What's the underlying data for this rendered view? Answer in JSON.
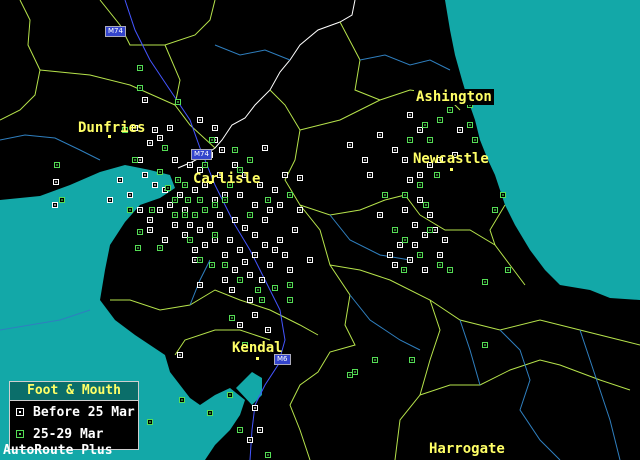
{
  "cities": [
    {
      "id": "dumfries",
      "name": "Dunfries"
    },
    {
      "id": "carlisle",
      "name": "Carlisle"
    },
    {
      "id": "kendal",
      "name": "Kendal"
    },
    {
      "id": "ashington",
      "name": "Ashington"
    },
    {
      "id": "newcastle",
      "name": "Newcastle"
    },
    {
      "id": "harrogate",
      "name": "Harrogate"
    }
  ],
  "road_signs": [
    "M74",
    "M74",
    "M6"
  ],
  "legend": {
    "title": "Foot & Mouth",
    "items": [
      {
        "label": "Before 25 Mar",
        "color": "#ffffff"
      },
      {
        "label": "25-29 Mar",
        "color": "#55dd55"
      }
    ]
  },
  "footer": {
    "brand": "AutoRoute Plus"
  },
  "colors": {
    "sea": "#13a8a8",
    "land": "#000000",
    "county_border": "#b6e34b",
    "region_border": "#2f7fbf",
    "country_border": "#ffffff",
    "road": "#4455ff",
    "label": "#ffff66"
  }
}
